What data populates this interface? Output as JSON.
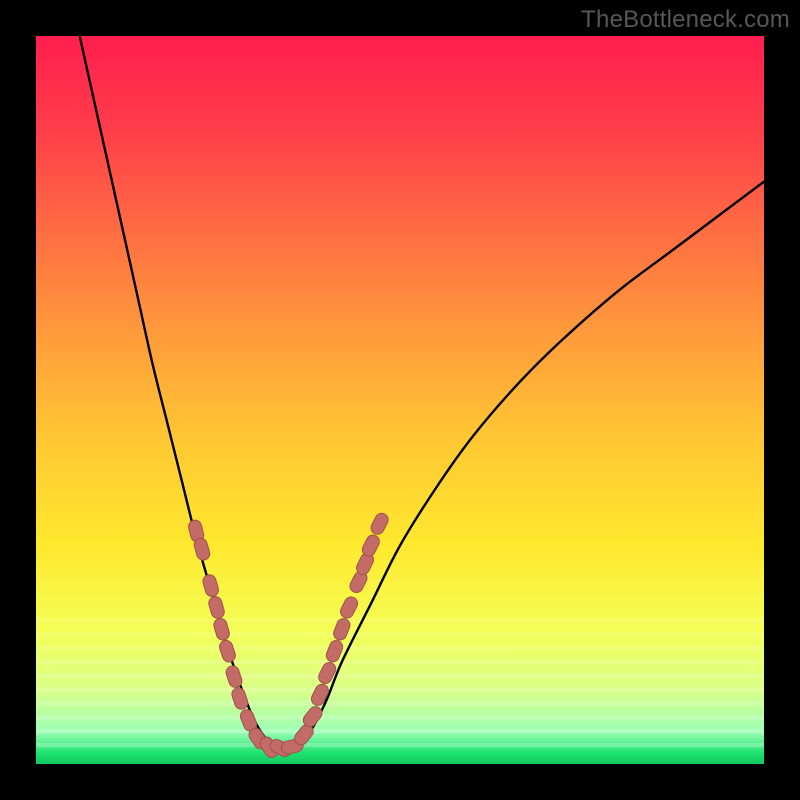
{
  "watermark": "TheBottleneck.com",
  "colors": {
    "frame": "#000000",
    "curve": "#000000",
    "marker_fill": "#c36b67",
    "marker_stroke": "#a24f4b",
    "green_band": "#1ee26f",
    "gradient_stops": [
      {
        "offset": 0.0,
        "color": "#ff1f4f"
      },
      {
        "offset": 0.12,
        "color": "#ff3b4a"
      },
      {
        "offset": 0.26,
        "color": "#ff6a43"
      },
      {
        "offset": 0.4,
        "color": "#ff983c"
      },
      {
        "offset": 0.55,
        "color": "#ffc633"
      },
      {
        "offset": 0.7,
        "color": "#ffe92e"
      },
      {
        "offset": 0.82,
        "color": "#f3ff57"
      },
      {
        "offset": 0.9,
        "color": "#d9ff8a"
      },
      {
        "offset": 0.955,
        "color": "#9cffb4"
      },
      {
        "offset": 0.985,
        "color": "#1ee26f"
      },
      {
        "offset": 1.0,
        "color": "#12c85e"
      }
    ]
  },
  "chart_data": {
    "type": "line",
    "title": "",
    "xlabel": "",
    "ylabel": "",
    "xlim": [
      0,
      100
    ],
    "ylim": [
      0,
      100
    ],
    "note": "x/y are in percent of inner plot width/height; y=0 is bottom, y=100 is top. Curve is a V-notch: steep dive from top-left, minimum around x≈30 y≈2, rising to x=100 y≈80.",
    "series": [
      {
        "name": "bottleneck-curve",
        "x": [
          6,
          8,
          10,
          12,
          14,
          16,
          18,
          20,
          22,
          24,
          26,
          28,
          30,
          32,
          34,
          36,
          38,
          40,
          42,
          46,
          50,
          55,
          60,
          66,
          72,
          80,
          88,
          96,
          100
        ],
        "y": [
          100,
          91,
          82,
          73,
          64,
          55,
          47,
          39,
          31,
          24,
          17,
          11,
          6,
          3,
          2,
          2.5,
          5,
          9,
          14,
          22,
          30,
          38,
          45,
          52,
          58,
          65,
          71,
          77,
          80
        ]
      }
    ],
    "markers": {
      "name": "highlighted-points",
      "note": "Salmon lozenge markers clustered on both arms near the notch bottom.",
      "points": [
        {
          "x": 22.0,
          "y": 32.0
        },
        {
          "x": 22.8,
          "y": 29.5
        },
        {
          "x": 24.0,
          "y": 24.5
        },
        {
          "x": 24.8,
          "y": 21.5
        },
        {
          "x": 25.5,
          "y": 18.5
        },
        {
          "x": 26.3,
          "y": 15.5
        },
        {
          "x": 27.2,
          "y": 12.0
        },
        {
          "x": 28.0,
          "y": 9.0
        },
        {
          "x": 29.2,
          "y": 6.0
        },
        {
          "x": 30.5,
          "y": 3.5
        },
        {
          "x": 32.0,
          "y": 2.3
        },
        {
          "x": 33.6,
          "y": 2.2
        },
        {
          "x": 35.2,
          "y": 2.4
        },
        {
          "x": 36.8,
          "y": 4.0
        },
        {
          "x": 38.0,
          "y": 6.5
        },
        {
          "x": 39.0,
          "y": 9.5
        },
        {
          "x": 40.0,
          "y": 12.5
        },
        {
          "x": 41.0,
          "y": 15.5
        },
        {
          "x": 42.0,
          "y": 18.5
        },
        {
          "x": 43.0,
          "y": 21.5
        },
        {
          "x": 44.3,
          "y": 25.0
        },
        {
          "x": 45.2,
          "y": 27.5
        },
        {
          "x": 46.0,
          "y": 30.0
        },
        {
          "x": 47.2,
          "y": 33.0
        }
      ]
    }
  }
}
